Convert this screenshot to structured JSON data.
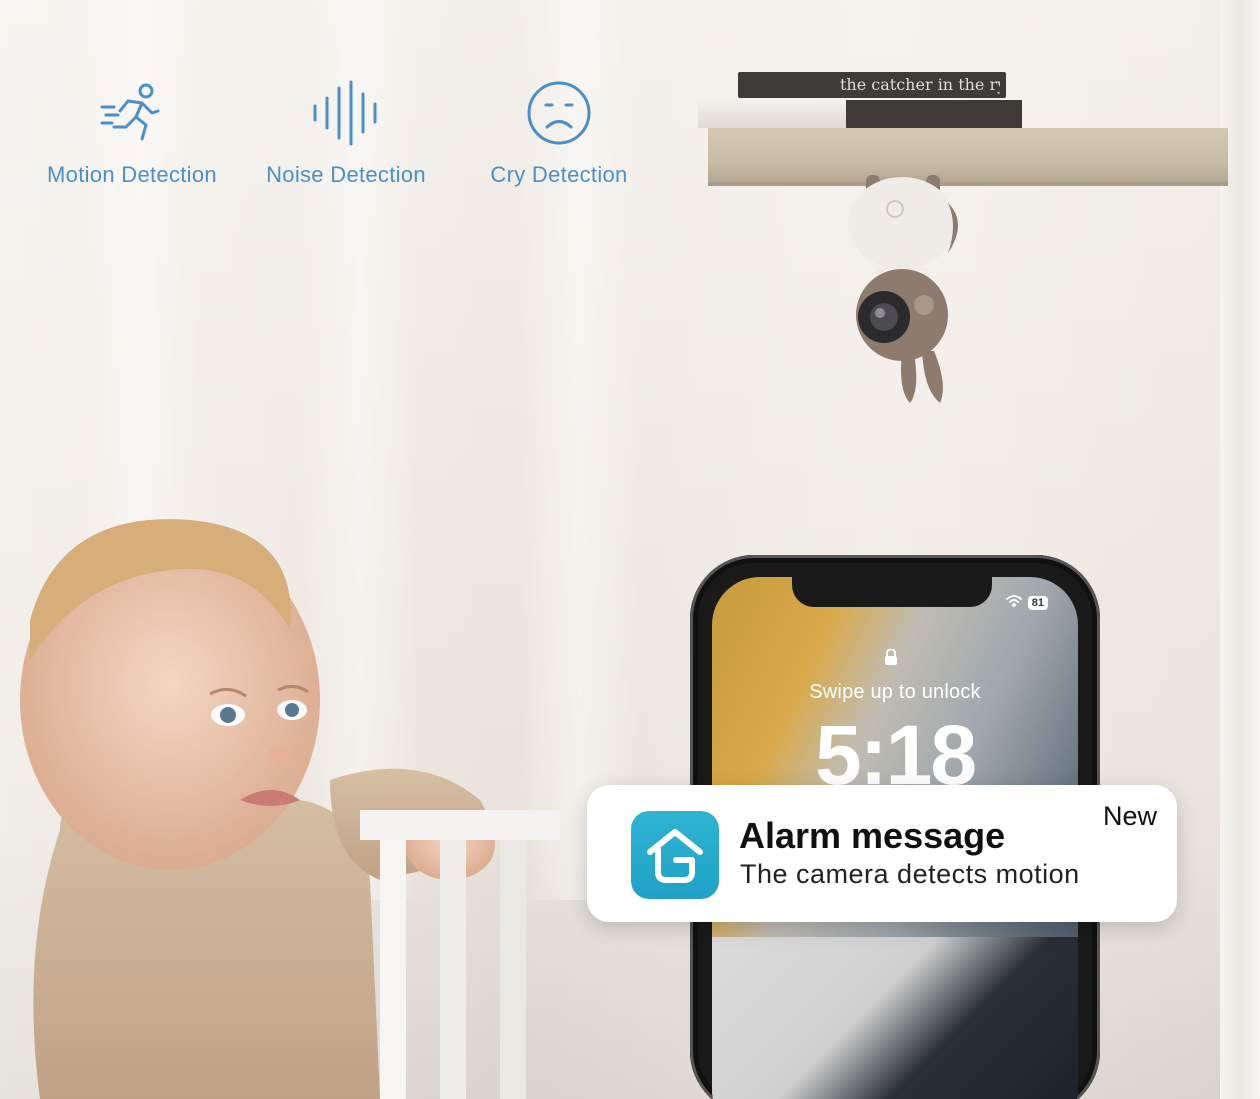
{
  "features": [
    {
      "label": "Motion Detection",
      "icon": "running-person-icon"
    },
    {
      "label": "Noise Detection",
      "icon": "sound-wave-icon"
    },
    {
      "label": "Cry Detection",
      "icon": "sad-face-icon"
    }
  ],
  "books": {
    "top": "the catcher in the rye"
  },
  "phone": {
    "battery": "81",
    "swipe_text": "Swipe up to unlock",
    "time": "5:18"
  },
  "notification": {
    "title": "Alarm message",
    "body": "The camera detects motion",
    "badge": "New",
    "app_icon": "home-g-icon"
  },
  "colors": {
    "feature_blue": "#4a8fc9",
    "app_icon_teal": "#1fa2c6"
  }
}
